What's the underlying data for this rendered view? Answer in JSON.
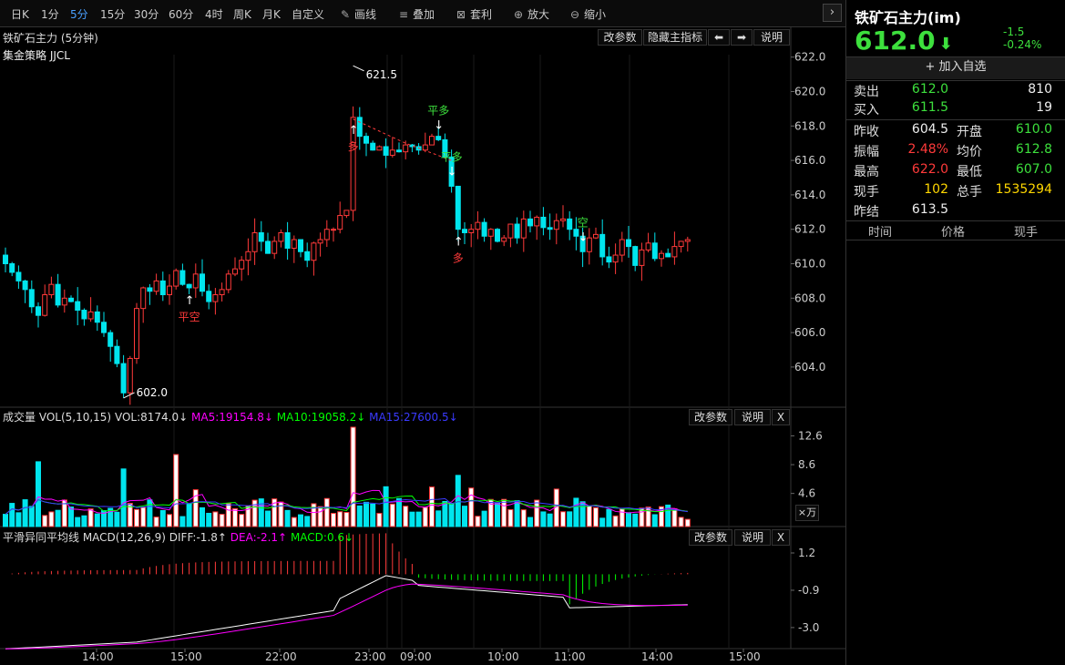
{
  "toolbar": {
    "periods": [
      "日K",
      "1分",
      "5分",
      "15分",
      "30分",
      "60分",
      "4时",
      "周K",
      "月K",
      "自定义"
    ],
    "active_period": "5分",
    "tools": [
      {
        "label": "画线",
        "icon": "pencil-icon"
      },
      {
        "label": "叠加",
        "icon": "stack-icon"
      },
      {
        "label": "套利",
        "icon": "arbitrage-icon"
      },
      {
        "label": "放大",
        "icon": "zoom-in-icon"
      },
      {
        "label": "缩小",
        "icon": "zoom-out-icon"
      }
    ],
    "next_icon": "chevron-right-icon"
  },
  "main_chart": {
    "title": "铁矿石主力 (5分钟)",
    "strategy": "集金策略 JJCL",
    "buttons": {
      "params": "改参数",
      "hide_indicator": "隐藏主指标",
      "left": "⬅",
      "right": "➡",
      "help": "说明"
    },
    "y_ticks": [
      "622.0",
      "620.0",
      "618.0",
      "616.0",
      "614.0",
      "612.0",
      "610.0",
      "608.0",
      "606.0",
      "604.0"
    ],
    "high_label": "621.5",
    "low_label": "602.0",
    "signals": [
      {
        "text": "平空",
        "color": "#ff3a3a"
      },
      {
        "text": "多",
        "color": "#ff3a3a"
      },
      {
        "text": "平多",
        "color": "#3de03d"
      },
      {
        "text": "平多",
        "color": "#3de03d"
      },
      {
        "text": "多",
        "color": "#ff3a3a"
      },
      {
        "text": "空",
        "color": "#3de03d"
      }
    ]
  },
  "volume_panel": {
    "title": "成交量 VOL(5,10,15)",
    "vol": "VOL:8174.0↓",
    "ma5": "MA5:19154.8↓",
    "ma10": "MA10:19058.2↓",
    "ma15": "MA15:27600.5↓",
    "buttons": {
      "params": "改参数",
      "help": "说明",
      "close": "X"
    },
    "y_ticks": [
      "12.6",
      "8.6",
      "4.6"
    ],
    "unit": "×万"
  },
  "macd_panel": {
    "title": "平滑异同平均线 MACD(12,26,9)",
    "diff": "DIFF:-1.8↑",
    "dea": "DEA:-2.1↑",
    "macd": "MACD:0.6↓",
    "buttons": {
      "params": "改参数",
      "help": "说明",
      "close": "X"
    },
    "y_ticks": [
      "1.2",
      "-0.9",
      "-3.0"
    ]
  },
  "x_axis": [
    "14:00",
    "15:00",
    "22:00",
    "23:00",
    "09:00",
    "10:00",
    "11:00",
    "14:00",
    "15:00"
  ],
  "colors": {
    "up": "#ff3a3a",
    "down": "#00e5ee",
    "ma5": "#ff00ff",
    "ma10": "#00ff00",
    "ma15": "#3a3aff",
    "diff": "#ffffff",
    "dea": "#ff00ff"
  },
  "sidebar": {
    "name": "铁矿石主力(im)",
    "price": "612.0",
    "change": "-1.5",
    "change_pct": "-0.24%",
    "add_watch": "加入自选",
    "ask_label": "卖出",
    "ask_price": "612.0",
    "ask_vol": "810",
    "bid_label": "买入",
    "bid_price": "611.5",
    "bid_vol": "19",
    "stats": [
      [
        {
          "label": "昨收",
          "value": "604.5",
          "color": "white"
        },
        {
          "label": "开盘",
          "value": "610.0",
          "color": "green"
        }
      ],
      [
        {
          "label": "振幅",
          "value": "2.48%",
          "color": "red"
        },
        {
          "label": "均价",
          "value": "612.8",
          "color": "green"
        }
      ],
      [
        {
          "label": "最高",
          "value": "622.0",
          "color": "red"
        },
        {
          "label": "最低",
          "value": "607.0",
          "color": "green"
        }
      ],
      [
        {
          "label": "现手",
          "value": "102",
          "color": "yellow"
        },
        {
          "label": "总手",
          "value": "1535294",
          "color": "yellow"
        }
      ],
      [
        {
          "label": "昨结",
          "value": "613.5",
          "color": "white"
        }
      ]
    ],
    "trade_headers": [
      "时间",
      "价格",
      "现手"
    ]
  }
}
